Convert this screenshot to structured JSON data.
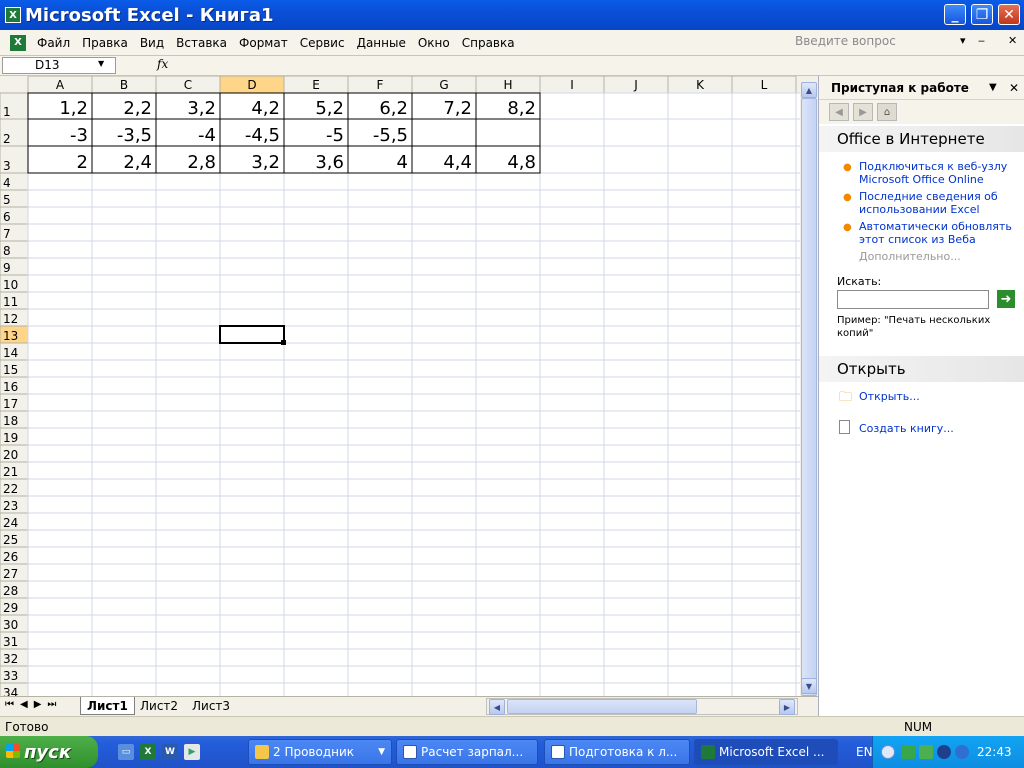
{
  "window": {
    "title": "Microsoft Excel - Книга1",
    "icon": "excel-icon",
    "controls": {
      "minimize": "_",
      "maximize": "❐",
      "close": "✕"
    }
  },
  "menubar": {
    "items": [
      "Файл",
      "Правка",
      "Вид",
      "Вставка",
      "Формат",
      "Сервис",
      "Данные",
      "Окно",
      "Справка"
    ],
    "question_placeholder": "Введите вопрос",
    "doc_controls": [
      "▾",
      "‒",
      "✕"
    ]
  },
  "formulabar": {
    "name_box": "D13",
    "fx": "fx",
    "formula": ""
  },
  "sheet": {
    "columns": [
      "A",
      "B",
      "C",
      "D",
      "E",
      "F",
      "G",
      "H",
      "I",
      "J",
      "K",
      "L"
    ],
    "selected_column": "D",
    "selected_row": 13,
    "selected_cell": "D13",
    "row_count_visible": 34,
    "rows": [
      [
        "1,2",
        "2,2",
        "3,2",
        "4,2",
        "5,2",
        "6,2",
        "7,2",
        "8,2"
      ],
      [
        "-3",
        "-3,5",
        "-4",
        "-4,5",
        "-5",
        "-5,5",
        "",
        ""
      ],
      [
        "2",
        "2,4",
        "2,8",
        "3,2",
        "3,6",
        "4",
        "4,4",
        "4,8"
      ]
    ],
    "tabs": [
      "Лист1",
      "Лист2",
      "Лист3"
    ],
    "active_tab": "Лист1"
  },
  "taskpane": {
    "title": "Приступая к работе",
    "section_online": "Office в Интернете",
    "links": [
      "Подключиться к веб-узлу Microsoft Office Online",
      "Последние сведения об использовании Excel",
      "Автоматически обновлять этот список из Веба"
    ],
    "more": "Дополнительно...",
    "search_label": "Искать:",
    "search_value": "",
    "example": "Пример: \"Печать нескольких копий\"",
    "section_open": "Открыть",
    "open_link": "Открыть...",
    "create_link": "Создать книгу..."
  },
  "status": {
    "left": "Готово",
    "right": "NUM"
  },
  "taskbar": {
    "start": "пуск",
    "tasks": [
      {
        "label": "2 Проводник",
        "icon": "folder-icon"
      },
      {
        "label": "Расчет зарпал...",
        "icon": "word-icon"
      },
      {
        "label": "Подготовка к л...",
        "icon": "word-icon"
      },
      {
        "label": "Microsoft Excel ...",
        "icon": "excel-icon"
      }
    ],
    "active_task": 3,
    "lang": "EN",
    "clock": "22:43"
  },
  "colors": {
    "title_blue": "#0a4fd6",
    "start_green": "#2f8f2c",
    "link_blue": "#0033cc",
    "bullet_orange": "#f28a00",
    "selection": "#000000"
  }
}
